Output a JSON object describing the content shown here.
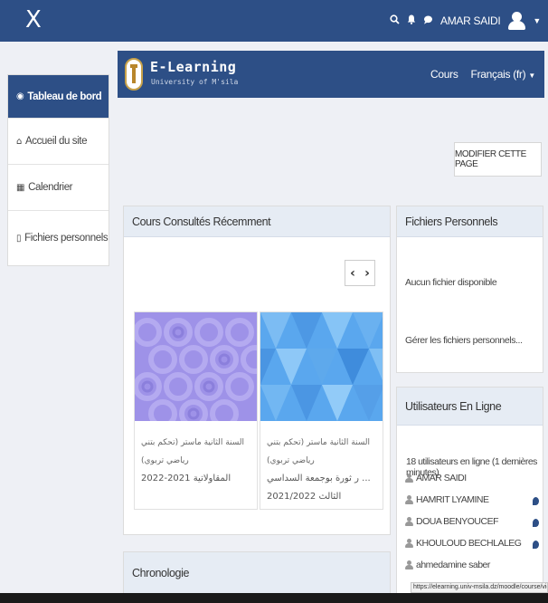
{
  "topbar": {
    "close_glyph": "X",
    "search_icon": "search-icon",
    "notification_icon": "bell-icon",
    "message_icon": "chat-icon",
    "user_name": "AMAR SAIDI",
    "color": "#2d4f86"
  },
  "banner": {
    "brand_title": "E-Learning",
    "brand_subtitle": "University of M'sila",
    "nav_cours": "Cours",
    "nav_language": "Français (fr)"
  },
  "sidebar": {
    "items": [
      {
        "label": "Tableau de bord",
        "icon": "dashboard-icon",
        "active": true
      },
      {
        "label": "Accueil du site",
        "icon": "home-icon",
        "active": false
      },
      {
        "label": "Calendrier",
        "icon": "calendar-icon",
        "active": false
      },
      {
        "label": "Fichiers personnels",
        "icon": "file-icon",
        "active": false
      }
    ]
  },
  "edit_page_label": "MODIFIER CETTE PAGE",
  "recent_courses": {
    "title": "Cours Consultés Récemment",
    "courses": [
      {
        "line1": "السنة الثانية ماستر (تحكم بتني رياضي تربوي)",
        "line2": "المقاولاتية 2021-2022"
      },
      {
        "line1": "السنة الثانية ماستر (تحكم بتني رياضي تربوي)",
        "line2": "... ر ثورة بوجمعة السداسي الثالث 2021/2022"
      }
    ]
  },
  "chronologie": {
    "title": "Chronologie"
  },
  "files": {
    "title": "Fichiers Personnels",
    "empty_message": "Aucun fichier disponible",
    "manage_link": "Gérer les fichiers personnels..."
  },
  "online_users": {
    "title": "Utilisateurs En Ligne",
    "count_text": "18 utilisateurs en ligne (1 dernières minutes)",
    "users": [
      {
        "name": "AMAR SAIDI",
        "message_icon": false
      },
      {
        "name": "HAMRIT LYAMINE",
        "message_icon": true
      },
      {
        "name": "DOUA BENYOUCEF",
        "message_icon": true
      },
      {
        "name": "KHOULOUD BECHLALEG",
        "message_icon": true
      },
      {
        "name": "ahmedamine saber",
        "message_icon": false
      }
    ]
  },
  "status_url": "https://elearning.univ-msila.dz/moodle/course/view.php?id=8"
}
